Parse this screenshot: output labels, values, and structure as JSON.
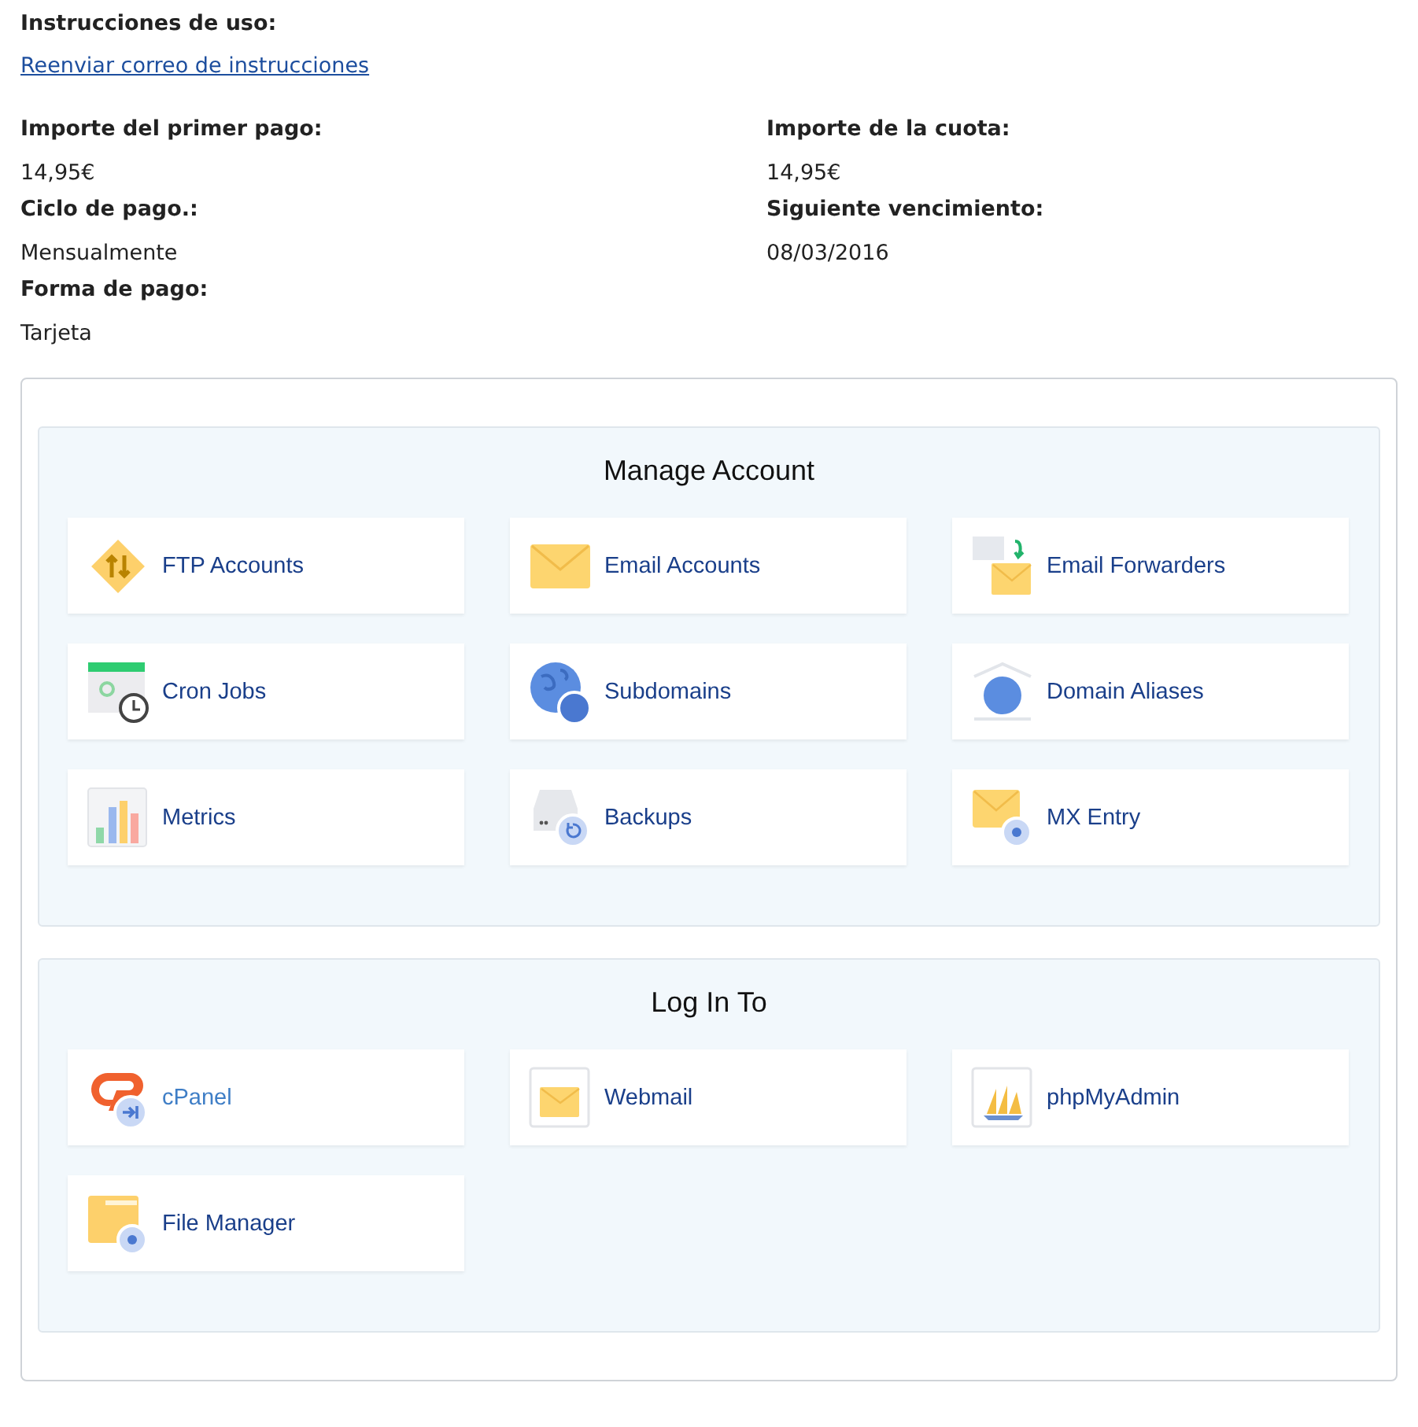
{
  "instructions": {
    "label": "Instrucciones de uso:",
    "link": "Reenviar correo de instrucciones"
  },
  "fields": [
    {
      "label": "Importe del primer pago:",
      "value": "14,95€"
    },
    {
      "label": "Importe de la cuota:",
      "value": "14,95€"
    },
    {
      "label": "Ciclo de pago.:",
      "value": "Mensualmente"
    },
    {
      "label": "Siguiente vencimiento:",
      "value": "08/03/2016"
    },
    {
      "label": "Forma de pago:",
      "value": "Tarjeta"
    }
  ],
  "sections": [
    {
      "title": "Manage Account",
      "items": [
        {
          "label": "FTP Accounts",
          "hovered": false
        },
        {
          "label": "Email Accounts",
          "hovered": false
        },
        {
          "label": "Email Forwarders",
          "hovered": false
        },
        {
          "label": "Cron Jobs",
          "hovered": false
        },
        {
          "label": "Subdomains",
          "hovered": false
        },
        {
          "label": "Domain Aliases",
          "hovered": false
        },
        {
          "label": "Metrics",
          "hovered": false
        },
        {
          "label": "Backups",
          "hovered": false
        },
        {
          "label": "MX Entry",
          "hovered": false
        }
      ]
    },
    {
      "title": "Log In To",
      "items": [
        {
          "label": "cPanel",
          "hovered": true
        },
        {
          "label": "Webmail",
          "hovered": false
        },
        {
          "label": "phpMyAdmin",
          "hovered": false
        },
        {
          "label": "File Manager",
          "hovered": false
        }
      ]
    }
  ]
}
